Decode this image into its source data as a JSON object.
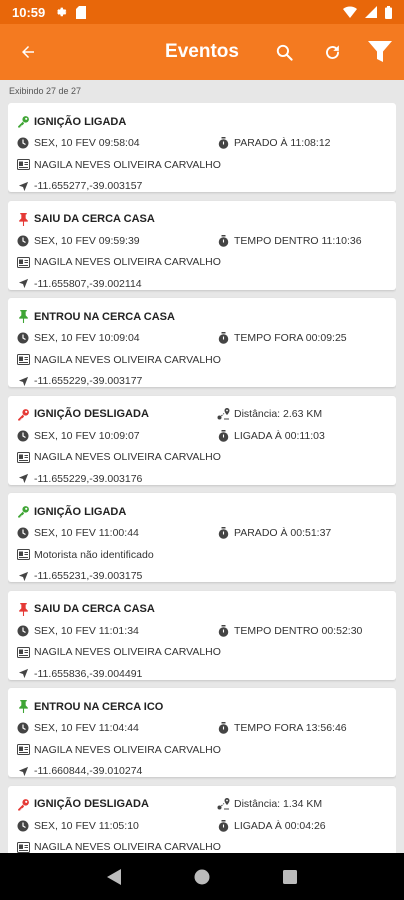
{
  "status": {
    "time": "10:59"
  },
  "header": {
    "title": "Eventos"
  },
  "list_info": {
    "count_text": "Exibindo 27 de 27"
  },
  "colors": {
    "accent": "#f47a20",
    "status_bar": "#e8670a",
    "green": "#3fa535",
    "red": "#e53935"
  },
  "events": [
    {
      "icon": "key-icon",
      "icon_color": "#3fa535",
      "title": "IGNIÇÃO LIGADA",
      "datetime": "SEX, 10 FEV 09:58:04",
      "stat_icon": "stopwatch-icon",
      "stat": "PARADO À 11:08:12",
      "driver": "NAGILA NEVES OLIVEIRA CARVALHO",
      "coords": "-11.655277,-39.003157"
    },
    {
      "icon": "pin-icon",
      "icon_color": "#e53935",
      "title": "SAIU DA  CERCA CASA",
      "datetime": "SEX, 10 FEV 09:59:39",
      "stat_icon": "stopwatch-icon",
      "stat": "TEMPO DENTRO 11:10:36",
      "driver": "NAGILA NEVES OLIVEIRA CARVALHO",
      "coords": "-11.655807,-39.002114"
    },
    {
      "icon": "pin-icon",
      "icon_color": "#3fa535",
      "title": "ENTROU NA  CERCA CASA",
      "datetime": "SEX, 10 FEV 10:09:04",
      "stat_icon": "stopwatch-icon",
      "stat": "TEMPO FORA  00:09:25",
      "driver": "NAGILA NEVES OLIVEIRA CARVALHO",
      "coords": "-11.655229,-39.003177"
    },
    {
      "icon": "key-icon",
      "icon_color": "#e53935",
      "title": "IGNIÇÃO DESLIGADA",
      "datetime": "SEX, 10 FEV 10:09:07",
      "stat_icon": "distance-icon",
      "stat": "Distância: 2.63 KM",
      "stat2_icon": "stopwatch-icon",
      "stat2": "LIGADA À 00:11:03",
      "driver": "NAGILA NEVES OLIVEIRA CARVALHO",
      "coords": "-11.655229,-39.003176"
    },
    {
      "icon": "key-icon",
      "icon_color": "#3fa535",
      "title": "IGNIÇÃO LIGADA",
      "datetime": "SEX, 10 FEV 11:00:44",
      "stat_icon": "stopwatch-icon",
      "stat": "PARADO À 00:51:37",
      "driver": "Motorista não identificado",
      "coords": "-11.655231,-39.003175"
    },
    {
      "icon": "pin-icon",
      "icon_color": "#e53935",
      "title": "SAIU DA  CERCA CASA",
      "datetime": "SEX, 10 FEV 11:01:34",
      "stat_icon": "stopwatch-icon",
      "stat": "TEMPO DENTRO 00:52:30",
      "driver": "NAGILA NEVES OLIVEIRA CARVALHO",
      "coords": "-11.655836,-39.004491"
    },
    {
      "icon": "pin-icon",
      "icon_color": "#3fa535",
      "title": "ENTROU NA  CERCA ICO",
      "datetime": "SEX, 10 FEV 11:04:44",
      "stat_icon": "stopwatch-icon",
      "stat": "TEMPO FORA  13:56:46",
      "driver": "NAGILA NEVES OLIVEIRA CARVALHO",
      "coords": "-11.660844,-39.010274"
    },
    {
      "icon": "key-icon",
      "icon_color": "#e53935",
      "title": "IGNIÇÃO DESLIGADA",
      "datetime": "SEX, 10 FEV 11:05:10",
      "stat_icon": "distance-icon",
      "stat": "Distância: 1.34 KM",
      "stat2_icon": "stopwatch-icon",
      "stat2": "LIGADA À 00:04:26",
      "driver": "NAGILA NEVES OLIVEIRA CARVALHO",
      "coords": ""
    }
  ]
}
